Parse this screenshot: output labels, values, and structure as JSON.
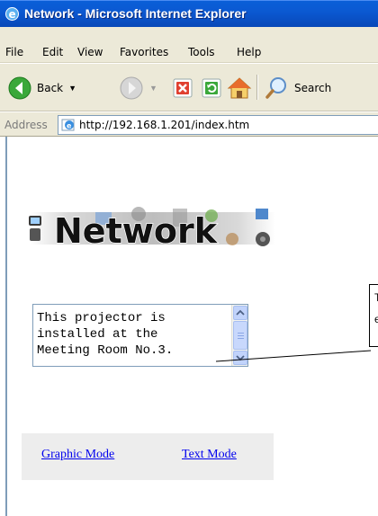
{
  "window": {
    "title": "Network - Microsoft Internet Explorer"
  },
  "menubar": {
    "items": [
      "File",
      "Edit",
      "View",
      "Favorites",
      "Tools",
      "Help"
    ]
  },
  "toolbar": {
    "back_label": "Back",
    "search_label": "Search"
  },
  "addressbar": {
    "label": "Address",
    "url": "http://192.168.1.201/index.htm"
  },
  "page": {
    "logo_text": "Network",
    "textarea_value": "This projector is\ninstalled at the\nMeeting Room No.3.",
    "links": {
      "graphic_mode": "Graphic Mode",
      "text_mode": "Text Mode"
    }
  },
  "callout": {
    "lines": [
      "T",
      "e"
    ]
  },
  "colors": {
    "titlebar": "#0b59d2",
    "chrome": "#ece9d8",
    "link": "#0000ee",
    "link_panel": "#ededed"
  },
  "icons": {
    "app": "ie-logo-icon",
    "back": "back-arrow-icon",
    "forward": "forward-arrow-icon",
    "stop": "stop-icon",
    "refresh": "refresh-icon",
    "home": "home-icon",
    "search": "search-icon",
    "page": "ie-page-icon"
  }
}
